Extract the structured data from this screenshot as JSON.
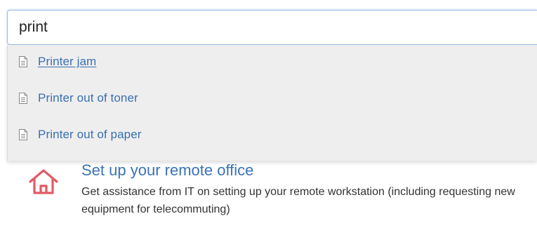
{
  "search": {
    "value": "print"
  },
  "suggestions": [
    {
      "label": "Printer jam",
      "icon": "document-icon"
    },
    {
      "label": "Printer out of toner",
      "icon": "document-icon"
    },
    {
      "label": "Printer out of paper",
      "icon": "document-icon"
    }
  ],
  "result": {
    "icon": "home-icon",
    "title": "Set up your remote office",
    "description": "Get assistance from IT on setting up your remote workstation (including requesting new equipment for telecommuting)"
  },
  "colors": {
    "link": "#3a6fb1",
    "result_title": "#3a73b8",
    "home_icon": "#e15a67",
    "dropdown_bg": "#eeeeee",
    "input_border": "#9cbbe2"
  }
}
